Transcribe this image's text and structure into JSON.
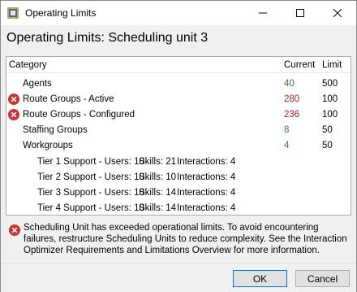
{
  "window": {
    "title": "Operating Limits",
    "minimize_glyph": "—",
    "maximize_glyph": "☐",
    "close_glyph": "✕"
  },
  "heading": "Operating Limits: Scheduling unit 3",
  "table": {
    "columns": {
      "category": "Category",
      "current": "Current",
      "limit": "Limit"
    },
    "rows": [
      {
        "name": "Agents",
        "current": "40",
        "limit": "500",
        "error": false
      },
      {
        "name": "Route Groups - Active",
        "current": "280",
        "limit": "100",
        "error": true
      },
      {
        "name": "Route Groups - Configured",
        "current": "236",
        "limit": "100",
        "error": true
      },
      {
        "name": "Staffing Groups",
        "current": "8",
        "limit": "50",
        "error": false
      },
      {
        "name": "Workgroups",
        "current": "4",
        "limit": "50",
        "error": false
      }
    ],
    "workgroups": [
      {
        "team": "Tier 1 Support - Users: 10",
        "skills": "Skills: 21",
        "interactions": "Interactions: 4"
      },
      {
        "team": "Tier 2 Support - Users: 10",
        "skills": "Skills: 10",
        "interactions": "Interactions: 4"
      },
      {
        "team": "Tier 3 Support - Users: 10",
        "skills": "Skills: 14",
        "interactions": "Interactions: 4"
      },
      {
        "team": "Tier 4 Support - Users: 10",
        "skills": "Skills: 14",
        "interactions": "Interactions: 4"
      }
    ]
  },
  "message": "Scheduling Unit has exceeded operational limits. To avoid encountering failures, restructure Scheduling Units to reduce complexity. See the Interaction Optimizer Requirements and Limitations Overview for more information.",
  "buttons": {
    "ok": "OK",
    "cancel": "Cancel"
  },
  "colors": {
    "ok_value": "#2e8b2e",
    "bad_value": "#b22222",
    "error_icon": "#d32f2f"
  },
  "icons": {
    "app": "app-icon",
    "error": "error-icon"
  }
}
